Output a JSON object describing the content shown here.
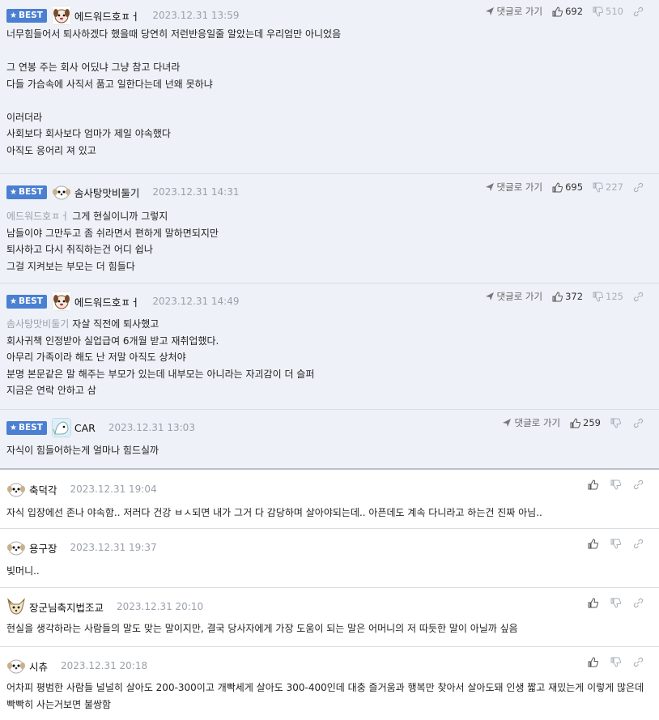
{
  "ui": {
    "best_label": "BEST",
    "reply_label": "댓글로 가기"
  },
  "comments": [
    {
      "nick": "에드워드호ㅍㅓ",
      "date": "2023.12.31 13:59",
      "up": "692",
      "down": "510",
      "mention": "",
      "text": "너무힘들어서 퇴사하겠다 했을때 당연히 저런반응일줄 알았는데 우리엄만 아니었음\n\n그 연봉 주는 회사 어딨냐 그냥 참고 다녀라\n다들 가슴속에 사직서 품고 일한다는데 넌왜 못하냐\n\n이러더라\n사회보다 회사보다 엄마가 제일 야속했다\n아직도 응어리 져 있고"
    },
    {
      "nick": "솜사탕맛비둘기",
      "date": "2023.12.31 14:31",
      "up": "695",
      "down": "227",
      "mention": "에드워드호ㅍㅓ",
      "text": "그게 현실이니까 그렇지\n남들이야 그만두고 좀 쉬라면서 편하게 말하면되지만\n퇴사하고 다시 취직하는건 어디 쉽나\n그걸 지켜보는 부모는 더 힘들다"
    },
    {
      "nick": "에드워드호ㅍㅓ",
      "date": "2023.12.31 14:49",
      "up": "372",
      "down": "125",
      "mention": "솜사탕맛비둘기",
      "text": "자살 직전에 퇴사했고\n회사귀책 인정받아 실업급여 6개월 받고 재취업했다.\n아무리 가족이라 해도 난 저말 아직도 상처야\n분명 본문같은 말 해주는 부모가 있는데 내부모는 아니라는 자괴감이 더 슬퍼\n지금은 연락 안하고 삼"
    },
    {
      "nick": "CAR",
      "date": "2023.12.31 13:03",
      "up": "259",
      "down": "",
      "mention": "",
      "text": "자식이 힘들어하는게 얼마나 힘드실까"
    },
    {
      "nick": "축덕각",
      "date": "2023.12.31 19:04",
      "text": "자식 입장에선 존나 야속함.. 저러다 건강 ㅂㅅ되면 내가 그거 다 감당하며 살아야되는데.. 아픈데도 계속 다니라고 하는건 진짜 아님.."
    },
    {
      "nick": "용구장",
      "date": "2023.12.31 19:37",
      "text": "빚머니.."
    },
    {
      "nick": "장군님축지법조교",
      "date": "2023.12.31 20:10",
      "text": "현실을 생각하라는 사람들의 말도 맞는 말이지만, 결국 당사자에게 가장 도움이 되는 말은 어머니의 저 따듯한 말이 아닐까 싶음"
    },
    {
      "nick": "시츄",
      "date": "2023.12.31 20:18",
      "text": "어차피 평범한 사람들 널널히 살아도 200-300이고 개빡세게 살아도 300-400인데 대충 즐거움과 행복만 찾아서 살아도돼 인생 짧고 재밌는게 이렇게 많은데 빡빡히 사는거보면 불쌍함"
    }
  ]
}
